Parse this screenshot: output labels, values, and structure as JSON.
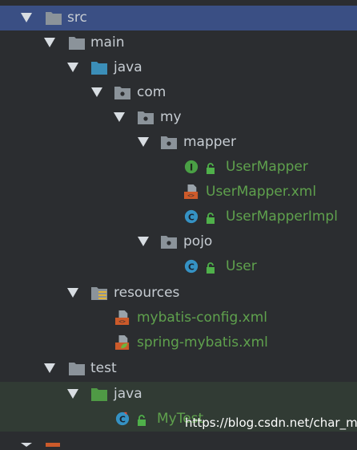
{
  "tree": {
    "src": {
      "label": "src"
    },
    "main": {
      "label": "main"
    },
    "main_java": {
      "label": "java"
    },
    "com": {
      "label": "com"
    },
    "my": {
      "label": "my"
    },
    "mapper": {
      "label": "mapper"
    },
    "user_mapper": {
      "label": "UserMapper"
    },
    "user_mapper_xml": {
      "label": "UserMapper.xml"
    },
    "user_mapper_impl": {
      "label": "UserMapperImpl"
    },
    "pojo": {
      "label": "pojo"
    },
    "user": {
      "label": "User"
    },
    "resources": {
      "label": "resources"
    },
    "mybatis_config": {
      "label": "mybatis-config.xml"
    },
    "spring_mybatis": {
      "label": "spring-mybatis.xml"
    },
    "test": {
      "label": "test"
    },
    "test_java": {
      "label": "java"
    },
    "my_test": {
      "label": "MyTest"
    }
  },
  "watermark": "https://blog.csdn.net/char_m",
  "colors": {
    "background": "#2b2d30",
    "selection": "#3a4f84",
    "default_text": "#c7cdd3",
    "vcs_added_text": "#5fa14d",
    "folder": "#8b939a",
    "source_folder": "#3b8eb8",
    "test_folder": "#4f9a45",
    "class_icon": "#3592c4",
    "interface_icon": "#4aa045",
    "xml_icon": "#cc5a2a"
  }
}
